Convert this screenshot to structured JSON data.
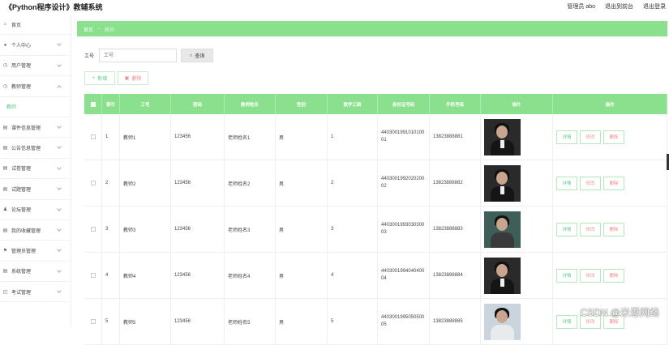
{
  "header": {
    "title": "《Python程序设计》教辅系统",
    "admin": "管理员 abo",
    "to_front": "退出到前台",
    "logout": "退出登录"
  },
  "sidebar": {
    "items": [
      {
        "label": "首页",
        "icon": "home-icon"
      },
      {
        "label": "个人中心",
        "icon": "user-icon"
      },
      {
        "label": "用户管理",
        "icon": "clock-icon"
      },
      {
        "label": "教师管理",
        "icon": "clock-icon"
      },
      {
        "label": "教师",
        "icon": ""
      },
      {
        "label": "课件信息管理",
        "icon": "grid-icon"
      },
      {
        "label": "公告信息管理",
        "icon": "grid-icon"
      },
      {
        "label": "试卷管理",
        "icon": "grid-icon"
      },
      {
        "label": "试题管理",
        "icon": "grid-icon"
      },
      {
        "label": "论坛管理",
        "icon": "person-icon"
      },
      {
        "label": "我的收藏管理",
        "icon": "grid-icon"
      },
      {
        "label": "管理员管理",
        "icon": "flag-icon"
      },
      {
        "label": "系统管理",
        "icon": "grid-icon"
      },
      {
        "label": "考试管理",
        "icon": "tag-icon"
      }
    ]
  },
  "breadcrumb": {
    "home": "首页",
    "sep": "→",
    "current": "教师"
  },
  "search": {
    "label": "工号",
    "placeholder": "工号",
    "button": "查询"
  },
  "actions": {
    "add": "新增",
    "delete": "删除"
  },
  "table": {
    "headers": [
      "索引",
      "工号",
      "密码",
      "教师姓名",
      "性别",
      "教学工龄",
      "身份证号码",
      "手机号码",
      "相片",
      "操作"
    ],
    "ops": {
      "detail": "详情",
      "edit": "修改",
      "delete": "删除"
    },
    "rows": [
      {
        "index": "1",
        "no": "教师1",
        "password": "123456",
        "name": "老师姓名1",
        "gender": "男",
        "years": "1",
        "idcard": "440300199101010001",
        "phone": "13823888881",
        "photo": "dark"
      },
      {
        "index": "2",
        "no": "教师2",
        "password": "123456",
        "name": "老师姓名2",
        "gender": "男",
        "years": "2",
        "idcard": "440300199202020002",
        "phone": "13823888882",
        "photo": "dark"
      },
      {
        "index": "3",
        "no": "教师3",
        "password": "123456",
        "name": "老师姓名3",
        "gender": "男",
        "years": "3",
        "idcard": "440300199303030003",
        "phone": "13823888883",
        "photo": "teal"
      },
      {
        "index": "4",
        "no": "教师4",
        "password": "123456",
        "name": "老师姓名4",
        "gender": "男",
        "years": "4",
        "idcard": "440300199404040004",
        "phone": "13823888884",
        "photo": "dark"
      },
      {
        "index": "5",
        "no": "教师5",
        "password": "123456",
        "name": "老师姓名5",
        "gender": "男",
        "years": "5",
        "idcard": "440300199505050005",
        "phone": "13823888885",
        "photo": "light"
      }
    ]
  },
  "watermark": "CSDN @米恩网络",
  "colors": {
    "accent": "#8be08e",
    "link_green": "#5cc98a",
    "danger": "#ee8888"
  }
}
